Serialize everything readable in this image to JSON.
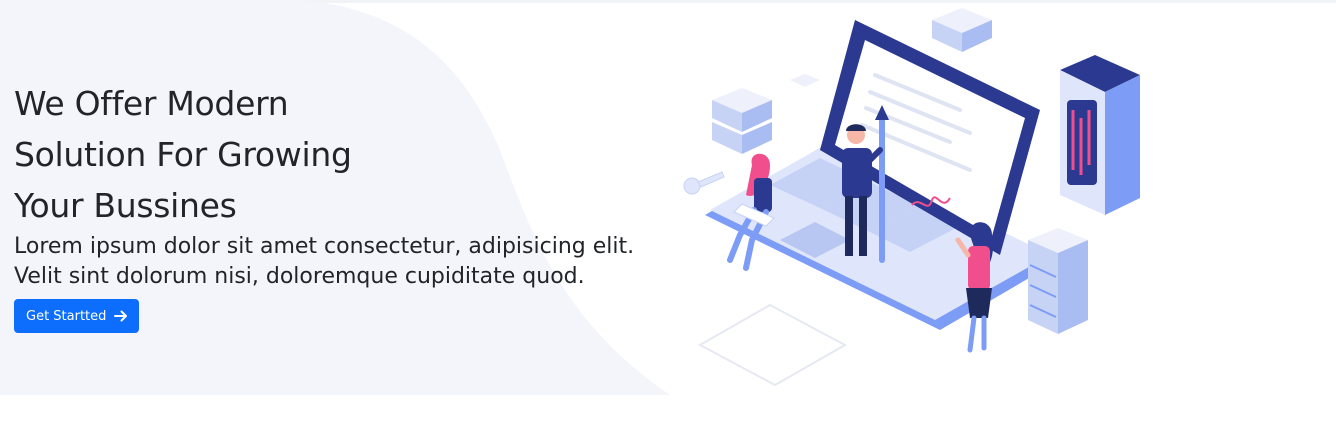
{
  "hero": {
    "headline_lines": [
      "We Offer Modern",
      "Solution For Growing",
      "Your Bussines"
    ],
    "subtext_lines": [
      "Lorem ipsum dolor sit amet consectetur, adipisicing elit.",
      "Velit sint dolorum nisi, doloremque cupiditate quod."
    ],
    "cta_label": "Get Startted",
    "cta_icon": "arrow-right-icon",
    "colors": {
      "accent": "#0d6efd",
      "blob": "#f3f5fb",
      "illustration_navy": "#2b3990",
      "illustration_blue": "#7c9cf5",
      "illustration_pink": "#f04e8c"
    }
  }
}
